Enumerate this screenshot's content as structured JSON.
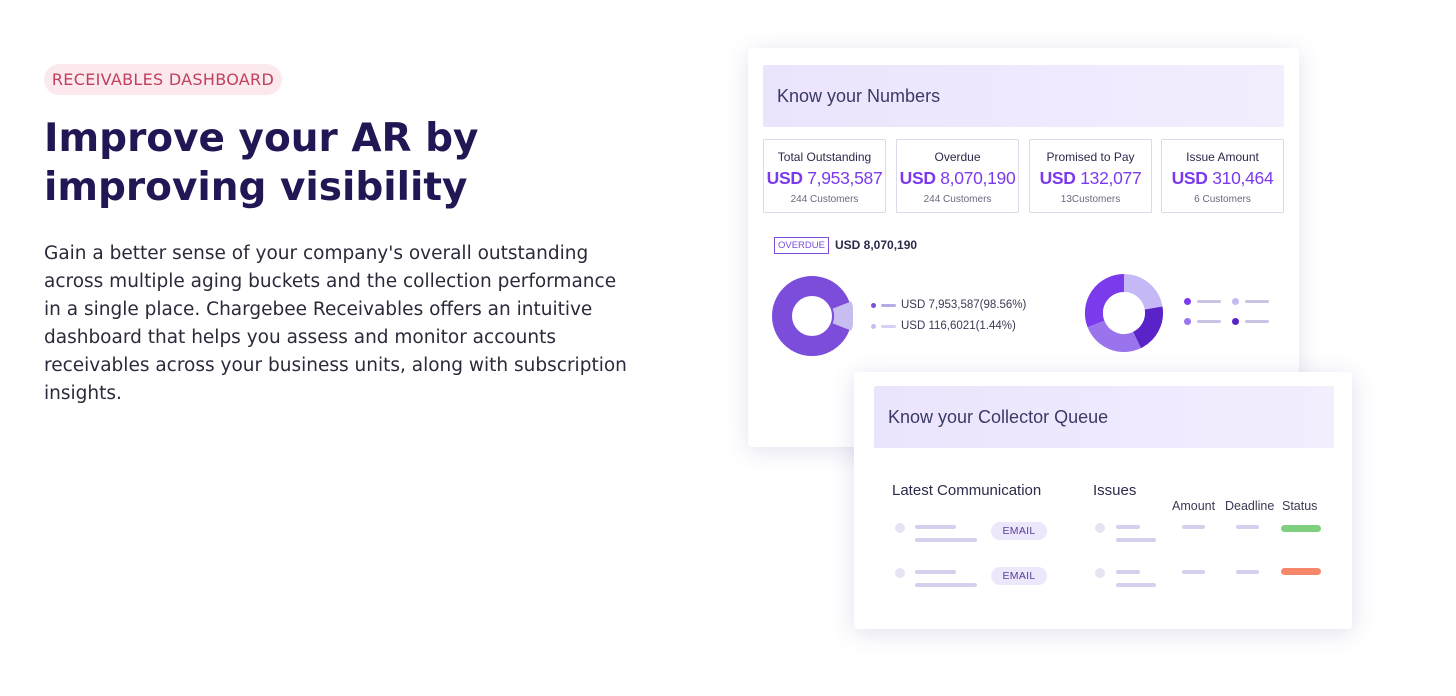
{
  "hero": {
    "badge": "RECEIVABLES DASHBOARD",
    "headline_line1": "Improve your AR by",
    "headline_line2": "improving visibility",
    "paragraph_lines": [
      "Gain a better sense of your company's overall outstanding",
      "across multiple aging buckets and the collection performance",
      "in a single place. Chargebee Receivables offers an intuitive",
      "dashboard that helps you assess and monitor accounts",
      "receivables across your business units, along with subscription",
      "insights."
    ]
  },
  "numbers_card": {
    "title": "Know your Numbers",
    "stats": [
      {
        "label": "Total Outstanding",
        "currency": "USD",
        "amount": "7,953,587",
        "sub": "244 Customers"
      },
      {
        "label": "Overdue",
        "currency": "USD",
        "amount": "8,070,190",
        "sub": "244 Customers"
      },
      {
        "label": "Promised to Pay",
        "currency": "USD",
        "amount": "132,077",
        "sub": "13Customers"
      },
      {
        "label": "Issue Amount",
        "currency": "USD",
        "amount": "310,464",
        "sub": "6 Customers"
      }
    ],
    "overdue_tag": "OVERDUE",
    "overdue_amount": "USD 8,070,190",
    "donut_legend": [
      {
        "text": "USD 7,953,587(98.56%)",
        "color": "#7c4ddb",
        "percent": 98.56
      },
      {
        "text": "USD 116,6021(1.44%)",
        "color": "#c8bdf0",
        "percent": 1.44
      }
    ]
  },
  "queue_card": {
    "title": "Know your Collector Queue",
    "col_latest": "Latest Communication",
    "col_issues": "Issues",
    "col_amount": "Amount",
    "col_deadline": "Deadline",
    "col_status": "Status",
    "rows": [
      {
        "channel": "EMAIL",
        "status_color": "#7fd07e"
      },
      {
        "channel": "EMAIL",
        "status_color": "#f7876a"
      }
    ]
  },
  "colors": {
    "accent": "#7c3aed",
    "headline": "#231654",
    "badge_text": "#c0405e",
    "badge_bg": "#fbe9ee"
  }
}
